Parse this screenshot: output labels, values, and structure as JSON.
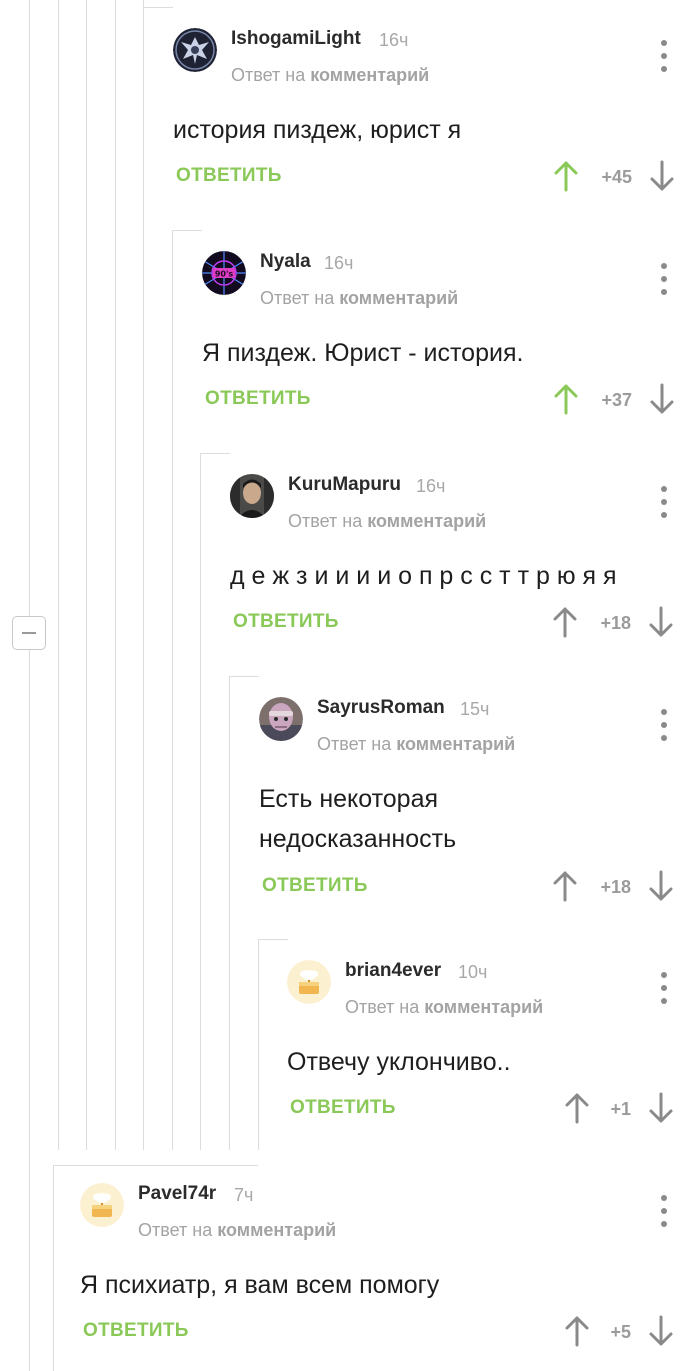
{
  "reply_to_prefix": "Ответ на",
  "reply_to_link": "комментарий",
  "reply_label": "ОТВЕТИТЬ",
  "colors": {
    "accent": "#8ac858",
    "upvoted": "#8ac858",
    "neutral": "#8a8a8a"
  },
  "comments": [
    {
      "author": "IshogamiLight",
      "time": "16ч",
      "text": [
        "история пиздеж, юрист я"
      ],
      "rating": "+45",
      "upvoted": true,
      "avatar": "eagle-emblem"
    },
    {
      "author": "Nyala",
      "time": "16ч",
      "text": [
        "Я пиздеж. Юрист - история."
      ],
      "rating": "+37",
      "upvoted": true,
      "avatar": "neon-web"
    },
    {
      "author": "KuruMapuru",
      "time": "16ч",
      "text": [
        "д е ж з и и и и о п р с с т т р ю я я"
      ],
      "rating": "+18",
      "upvoted": false,
      "avatar": "photo-portrait"
    },
    {
      "author": "SayrusRoman",
      "time": "15ч",
      "text": [
        "Есть некоторая",
        "недосказанность"
      ],
      "rating": "+18",
      "upvoted": false,
      "avatar": "masked-face"
    },
    {
      "author": "brian4ever",
      "time": "10ч",
      "text": [
        "Отвечу уклончиво.."
      ],
      "rating": "+1",
      "upvoted": false,
      "avatar": "default-cake"
    },
    {
      "author": "Pavel74r",
      "time": "7ч",
      "text": [
        "Я психиатр, я вам всем помогу"
      ],
      "rating": "+5",
      "upvoted": false,
      "avatar": "default-cake"
    }
  ]
}
